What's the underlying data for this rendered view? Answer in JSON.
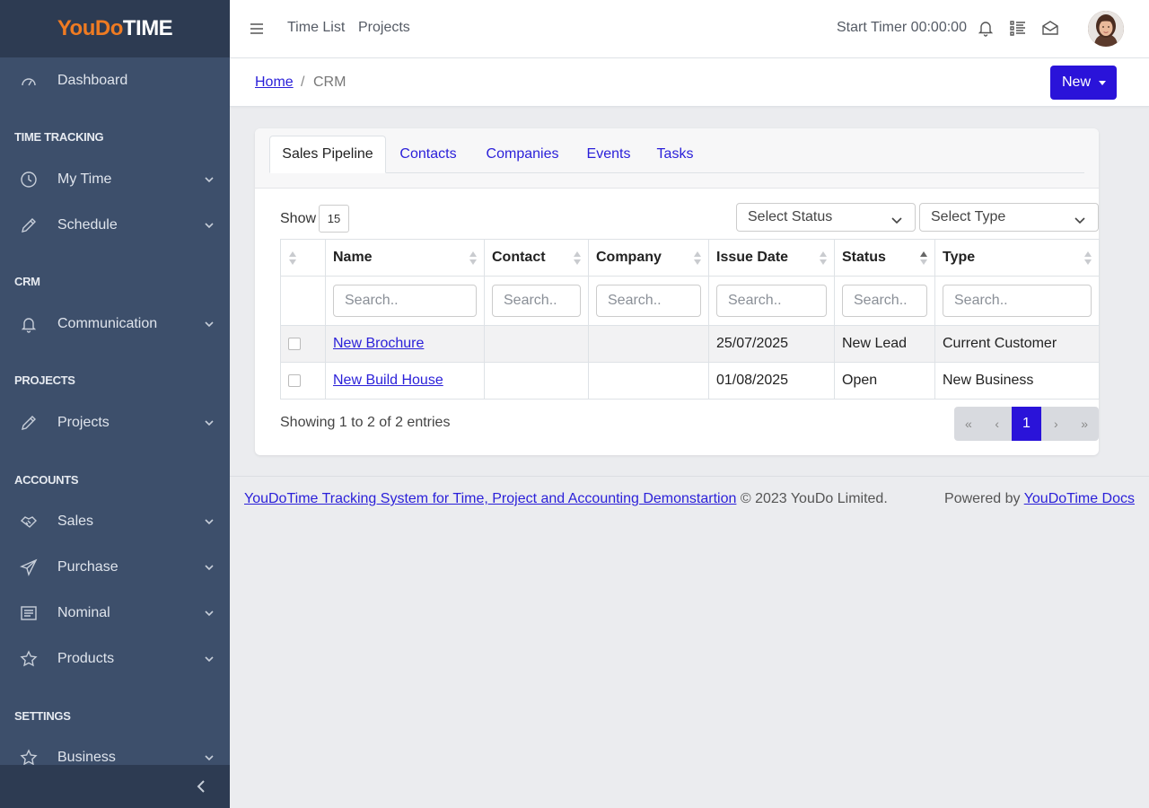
{
  "brand": {
    "part1": "YouDo",
    "part2": "TIME"
  },
  "sidebar": {
    "items": [
      {
        "label": "Dashboard",
        "icon": "dashboard-gauge-icon"
      },
      {
        "section": "TIME TRACKING"
      },
      {
        "label": "My Time",
        "icon": "clock-icon"
      },
      {
        "label": "Schedule",
        "icon": "pencil-icon"
      },
      {
        "section": "CRM"
      },
      {
        "label": "Communication",
        "icon": "bell-icon"
      },
      {
        "section": "PROJECTS"
      },
      {
        "label": "Projects",
        "icon": "pencil-icon"
      },
      {
        "section": "ACCOUNTS"
      },
      {
        "label": "Sales",
        "icon": "handshake-icon"
      },
      {
        "label": "Purchase",
        "icon": "send-icon"
      },
      {
        "label": "Nominal",
        "icon": "list-icon"
      },
      {
        "label": "Products",
        "icon": "star-icon"
      },
      {
        "section": "SETTINGS"
      },
      {
        "label": "Business",
        "icon": "star-icon"
      }
    ]
  },
  "topbar": {
    "links": [
      "Time List",
      "Projects"
    ],
    "timer": "Start Timer 00:00:00"
  },
  "breadcrumb": {
    "home": "Home",
    "separator": "/",
    "current": "CRM"
  },
  "new_button": "New",
  "tabs": [
    "Sales Pipeline",
    "Contacts",
    "Companies",
    "Events",
    "Tasks"
  ],
  "active_tab": "Sales Pipeline",
  "table": {
    "show_label": "Show",
    "page_size": "15",
    "filters": {
      "status": "Select Status",
      "type": "Select Type"
    },
    "columns": [
      "Name",
      "Contact",
      "Company",
      "Issue Date",
      "Status",
      "Type"
    ],
    "search_placeholder": "Search..",
    "rows": [
      {
        "name": "New Brochure",
        "contact": "",
        "company": "",
        "issue_date": "25/07/2025",
        "status": "New Lead",
        "type": "Current Customer"
      },
      {
        "name": "New Build House",
        "contact": "",
        "company": "",
        "issue_date": "01/08/2025",
        "status": "Open",
        "type": "New Business"
      }
    ],
    "showing": "Showing 1 to 2 of 2 entries",
    "pager": {
      "first": "«",
      "prev": "‹",
      "current": "1",
      "next": "›",
      "last": "»"
    }
  },
  "footer": {
    "link_text": "YouDoTime Tracking System for Time, Project and Accounting Demonstartion",
    "copyright": "© 2023 YouDo Limited.",
    "powered_label": "Powered by",
    "powered_link": "YouDoTime Docs"
  },
  "colors": {
    "accent": "#2a13d9",
    "sidebar": "#3d4f6b",
    "sidebar_dark": "#2d3b52",
    "brand_orange": "#ef7b22"
  }
}
